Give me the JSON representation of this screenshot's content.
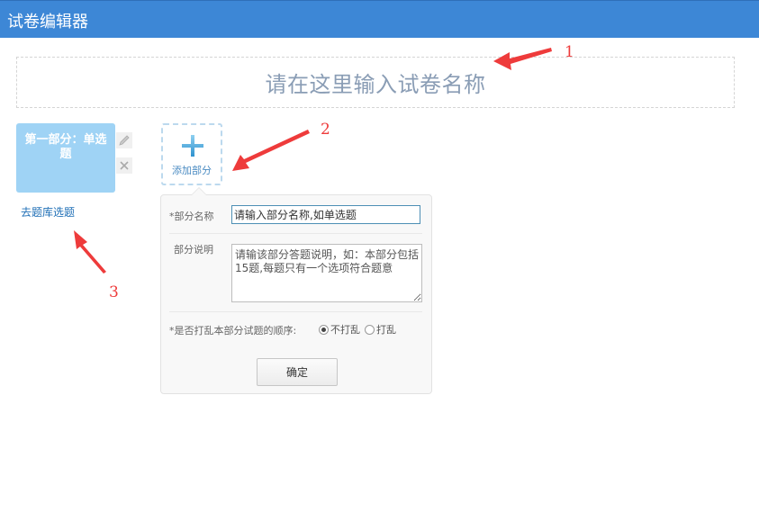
{
  "header": {
    "title": "试卷编辑器"
  },
  "paper": {
    "name_placeholder": "请在这里输入试卷名称"
  },
  "section_card": {
    "label": "第一部分：单选题"
  },
  "sidebar": {
    "bank_link": "去题库选题"
  },
  "add_section": {
    "label": "添加部分"
  },
  "panel": {
    "name_label": "*部分名称",
    "name_value": "请输入部分名称,如单选题",
    "desc_label": "部分说明",
    "desc_value": "请输该部分答题说明，如：本部分包括15题,每题只有一个选项符合题意",
    "shuffle_label": "*是否打乱本部分试题的顺序:",
    "options": [
      {
        "label": "不打乱",
        "selected": true
      },
      {
        "label": "打乱",
        "selected": false
      }
    ],
    "confirm": "确定"
  },
  "annotations": [
    "1",
    "2",
    "3"
  ],
  "colors": {
    "header": "#3d87d6",
    "card": "#9fd3f5",
    "annotation": "#ee3b3b",
    "link": "#1f6fb6"
  }
}
